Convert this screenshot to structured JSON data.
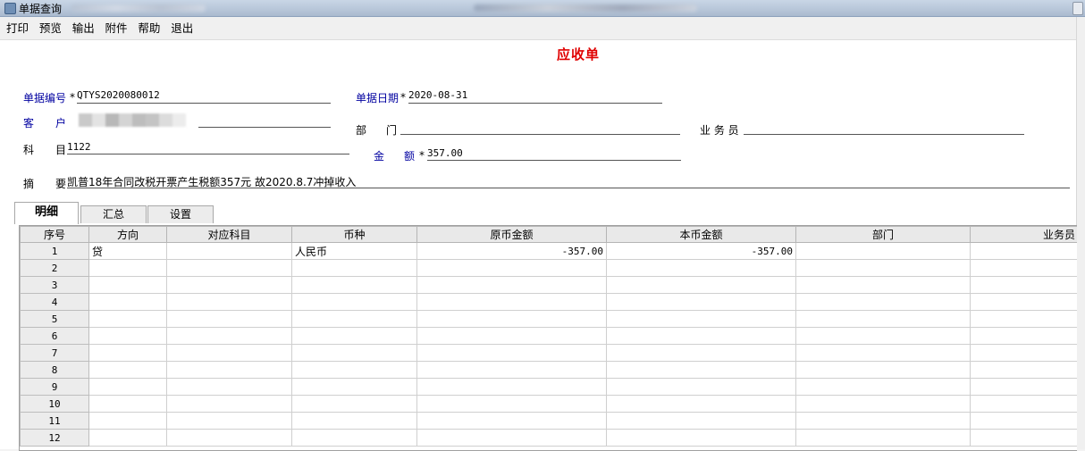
{
  "window": {
    "title": "单据查询"
  },
  "menu": [
    "打印",
    "预览",
    "输出",
    "附件",
    "帮助",
    "退出"
  ],
  "doc_title": "应收单",
  "colors": {
    "title_red": "#e00000",
    "label_blue": "#0000a0"
  },
  "fields": {
    "doc_no": {
      "label": "单据编号",
      "required": "*",
      "value": "QTYS2020080012"
    },
    "doc_date": {
      "label": "单据日期",
      "required": "*",
      "value": "2020-08-31"
    },
    "customer": {
      "label_a": "客",
      "label_b": "户",
      "value": ""
    },
    "department": {
      "label_a": "部",
      "label_b": "门",
      "value": ""
    },
    "salesperson": {
      "label": "业 务 员",
      "value": ""
    },
    "subject": {
      "label_a": "科",
      "label_b": "目",
      "value": "1122"
    },
    "amount": {
      "label_a": "金",
      "label_b": "额",
      "required": "*",
      "value": "357.00"
    },
    "summary": {
      "label_a": "摘",
      "label_b": "要",
      "value": "凯普18年合同改税开票产生税额357元 故2020.8.7冲掉收入"
    }
  },
  "tabs": [
    "明细",
    "汇总",
    "设置"
  ],
  "grid": {
    "columns": [
      "序号",
      "方向",
      "对应科目",
      "币种",
      "原币金额",
      "本币金额",
      "部门",
      "业务员"
    ],
    "rows": [
      {
        "no": "1",
        "direction": "贷",
        "subject": "",
        "currency": "人民币",
        "orig_amount": "-357.00",
        "local_amount": "-357.00",
        "dept": "",
        "staff": ""
      },
      {
        "no": "2",
        "direction": "",
        "subject": "",
        "currency": "",
        "orig_amount": "",
        "local_amount": "",
        "dept": "",
        "staff": ""
      },
      {
        "no": "3",
        "direction": "",
        "subject": "",
        "currency": "",
        "orig_amount": "",
        "local_amount": "",
        "dept": "",
        "staff": ""
      },
      {
        "no": "4",
        "direction": "",
        "subject": "",
        "currency": "",
        "orig_amount": "",
        "local_amount": "",
        "dept": "",
        "staff": ""
      },
      {
        "no": "5",
        "direction": "",
        "subject": "",
        "currency": "",
        "orig_amount": "",
        "local_amount": "",
        "dept": "",
        "staff": ""
      },
      {
        "no": "6",
        "direction": "",
        "subject": "",
        "currency": "",
        "orig_amount": "",
        "local_amount": "",
        "dept": "",
        "staff": ""
      },
      {
        "no": "7",
        "direction": "",
        "subject": "",
        "currency": "",
        "orig_amount": "",
        "local_amount": "",
        "dept": "",
        "staff": ""
      },
      {
        "no": "8",
        "direction": "",
        "subject": "",
        "currency": "",
        "orig_amount": "",
        "local_amount": "",
        "dept": "",
        "staff": ""
      },
      {
        "no": "9",
        "direction": "",
        "subject": "",
        "currency": "",
        "orig_amount": "",
        "local_amount": "",
        "dept": "",
        "staff": ""
      },
      {
        "no": "10",
        "direction": "",
        "subject": "",
        "currency": "",
        "orig_amount": "",
        "local_amount": "",
        "dept": "",
        "staff": ""
      },
      {
        "no": "11",
        "direction": "",
        "subject": "",
        "currency": "",
        "orig_amount": "",
        "local_amount": "",
        "dept": "",
        "staff": ""
      },
      {
        "no": "12",
        "direction": "",
        "subject": "",
        "currency": "",
        "orig_amount": "",
        "local_amount": "",
        "dept": "",
        "staff": ""
      }
    ]
  }
}
